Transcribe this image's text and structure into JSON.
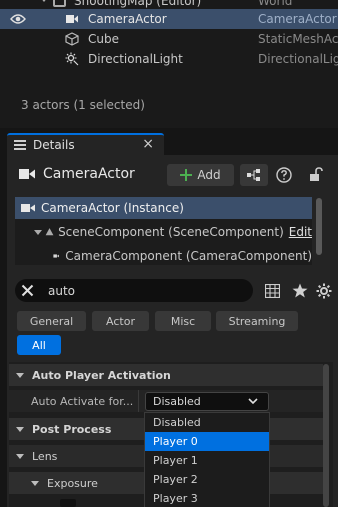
{
  "outliner": {
    "partial_row": {
      "name": "ShootingMap (Editor)",
      "type": "World"
    },
    "rows": [
      {
        "name": "CameraActor",
        "type": "CameraActor"
      },
      {
        "name": "Cube",
        "type": "StaticMeshAct"
      },
      {
        "name": "DirectionalLight",
        "type": "DirectionalLig"
      }
    ],
    "status": "3 actors (1 selected)"
  },
  "details": {
    "tab_label": "Details",
    "close_glyph": "×",
    "actor_name": "CameraActor",
    "add_label": "Add",
    "components": [
      {
        "label": "CameraActor (Instance)"
      },
      {
        "label": "SceneComponent (SceneComponent)",
        "edit": "Edit"
      },
      {
        "label": "CameraComponent (CameraComponent)"
      }
    ],
    "search_value": "auto",
    "filters": [
      "General",
      "Actor",
      "Misc",
      "Streaming",
      "All"
    ],
    "categories": {
      "auto_player": "Auto Player Activation",
      "post_process": "Post Process",
      "lens": "Lens",
      "exposure": "Exposure"
    },
    "auto_activate_label": "Auto Activate for...",
    "auto_activate_value": "Disabled",
    "dropdown_options": [
      "Disabled",
      "Player 0",
      "Player 1",
      "Player 2",
      "Player 3"
    ],
    "dropdown_highlighted": "Player 0"
  },
  "colors": {
    "accent": "#0070e0",
    "selection": "#3b4f6b",
    "background": "#242424"
  }
}
